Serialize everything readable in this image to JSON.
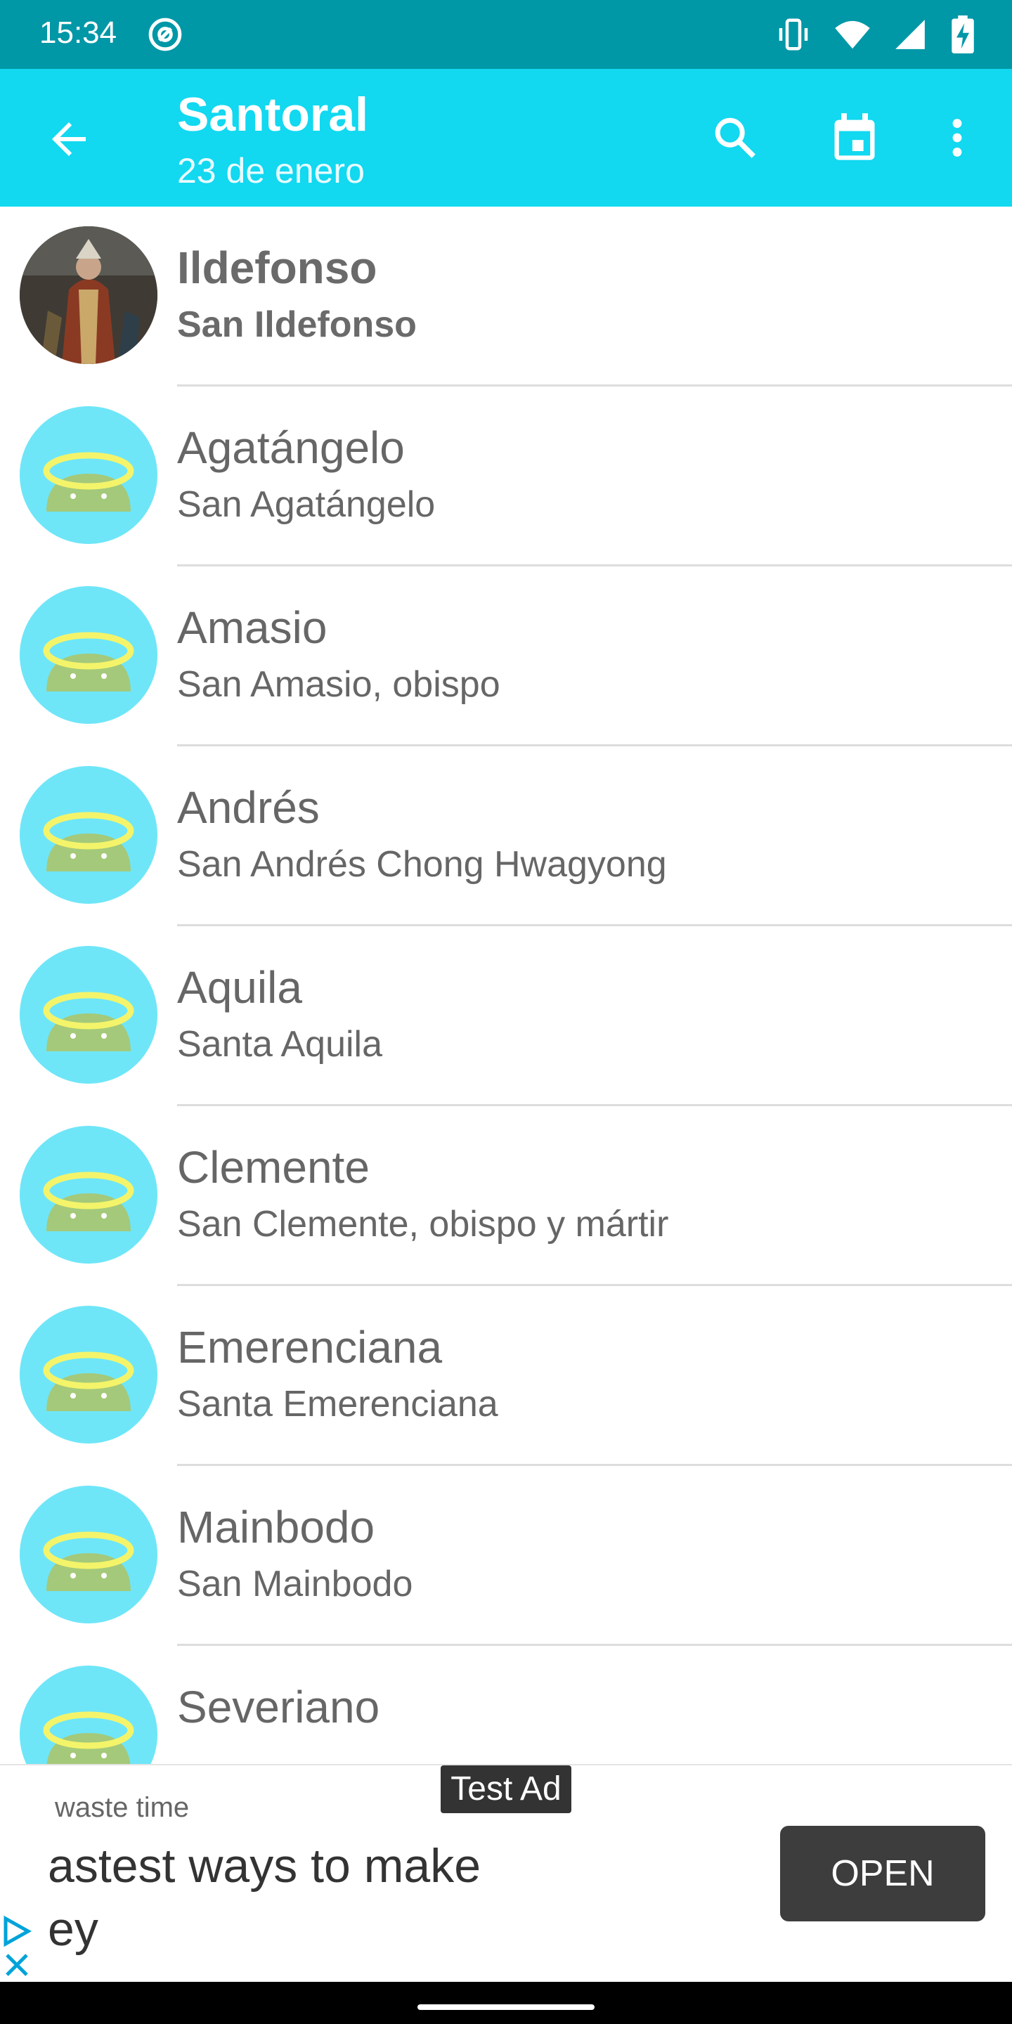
{
  "status_bar": {
    "time": "15:34",
    "icons": [
      "at-sign-icon",
      "vibrate-icon",
      "wifi-icon",
      "signal-icon",
      "battery-charging-icon"
    ]
  },
  "toolbar": {
    "title": "Santoral",
    "subtitle": "23 de enero",
    "icons": [
      "back-arrow-icon",
      "search-icon",
      "calendar-icon",
      "more-vert-icon"
    ]
  },
  "saints": [
    {
      "name": "Ildefonso",
      "description": "San Ildefonso",
      "highlighted": true,
      "avatar": "saint-portrait"
    },
    {
      "name": "Agatángelo",
      "description": "San Agatángelo",
      "highlighted": false,
      "avatar": "android-halo-icon"
    },
    {
      "name": "Amasio",
      "description": "San Amasio, obispo",
      "highlighted": false,
      "avatar": "android-halo-icon"
    },
    {
      "name": "Andrés",
      "description": "San Andrés Chong Hwagyong",
      "highlighted": false,
      "avatar": "android-halo-icon"
    },
    {
      "name": "Aquila",
      "description": "Santa Aquila",
      "highlighted": false,
      "avatar": "android-halo-icon"
    },
    {
      "name": "Clemente",
      "description": "San Clemente, obispo y mártir",
      "highlighted": false,
      "avatar": "android-halo-icon"
    },
    {
      "name": "Emerenciana",
      "description": "Santa Emerenciana",
      "highlighted": false,
      "avatar": "android-halo-icon"
    },
    {
      "name": "Mainbodo",
      "description": "San Mainbodo",
      "highlighted": false,
      "avatar": "android-halo-icon"
    },
    {
      "name": "Severiano",
      "description": "",
      "highlighted": false,
      "avatar": "android-halo-icon"
    }
  ],
  "ad": {
    "badge": "Test Ad",
    "small_text": "waste time",
    "headline_line1": "astest ways to make",
    "headline_line2": "ey",
    "cta": "OPEN"
  },
  "colors": {
    "status_bar": "#0097a7",
    "toolbar": "#12d8f0",
    "avatar_bg": "#6ee6f8",
    "android_green": "#a4c97a",
    "halo_yellow": "#f4f46a"
  }
}
